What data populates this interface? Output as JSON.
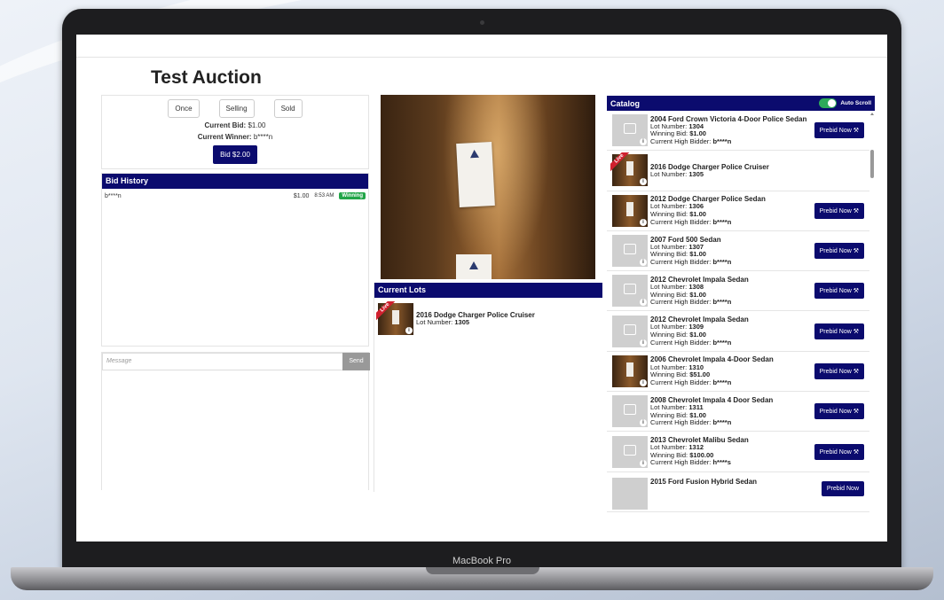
{
  "device_label": "MacBook Pro",
  "page": {
    "title": "Test Auction"
  },
  "bid_panel": {
    "buttons": [
      "Once",
      "Selling",
      "Sold"
    ],
    "current_bid_label": "Current Bid:",
    "current_bid_value": "$1.00",
    "current_winner_label": "Current Winner:",
    "current_winner_value": "b****n",
    "bid_button": "Bid $2.00"
  },
  "bid_history": {
    "title": "Bid History",
    "rows": [
      {
        "bidder": "b****n",
        "amount": "$1.00",
        "time": "8:53 AM",
        "status": "Winning"
      }
    ]
  },
  "chat": {
    "placeholder": "Message",
    "send": "Send"
  },
  "current_lots": {
    "title": "Current Lots",
    "items": [
      {
        "name": "2016 Dodge Charger Police Cruiser",
        "lot_label": "Lot Number:",
        "lot": "1305",
        "live": "Live"
      }
    ]
  },
  "catalog": {
    "title": "Catalog",
    "auto_scroll": "Auto Scroll",
    "lot_label": "Lot Number:",
    "winning_label": "Winning Bid:",
    "bidder_label": "Current High Bidder:",
    "prebid_label": "Prebid Now",
    "items": [
      {
        "name": "2004 Ford Crown Victoria 4-Door Police Sedan",
        "lot": "1304",
        "bid": "$1.00",
        "bidder": "b****n"
      },
      {
        "name": "2016 Dodge Charger Police Cruiser",
        "lot": "1305",
        "live": "Live"
      },
      {
        "name": "2012 Dodge Charger Police Sedan",
        "lot": "1306",
        "bid": "$1.00",
        "bidder": "b****n"
      },
      {
        "name": "2007 Ford 500 Sedan",
        "lot": "1307",
        "bid": "$1.00",
        "bidder": "b****n"
      },
      {
        "name": "2012 Chevrolet Impala Sedan",
        "lot": "1308",
        "bid": "$1.00",
        "bidder": "b****n"
      },
      {
        "name": "2012 Chevrolet Impala Sedan",
        "lot": "1309",
        "bid": "$1.00",
        "bidder": "b****n"
      },
      {
        "name": "2006 Chevrolet Impala 4-Door Sedan",
        "lot": "1310",
        "bid": "$51.00",
        "bidder": "b****n"
      },
      {
        "name": "2008 Chevrolet Impala 4 Door Sedan",
        "lot": "1311",
        "bid": "$1.00",
        "bidder": "b****n"
      },
      {
        "name": "2013 Chevrolet Malibu Sedan",
        "lot": "1312",
        "bid": "$100.00",
        "bidder": "h****s"
      },
      {
        "name": "2015 Ford Fusion Hybrid Sedan"
      }
    ]
  }
}
